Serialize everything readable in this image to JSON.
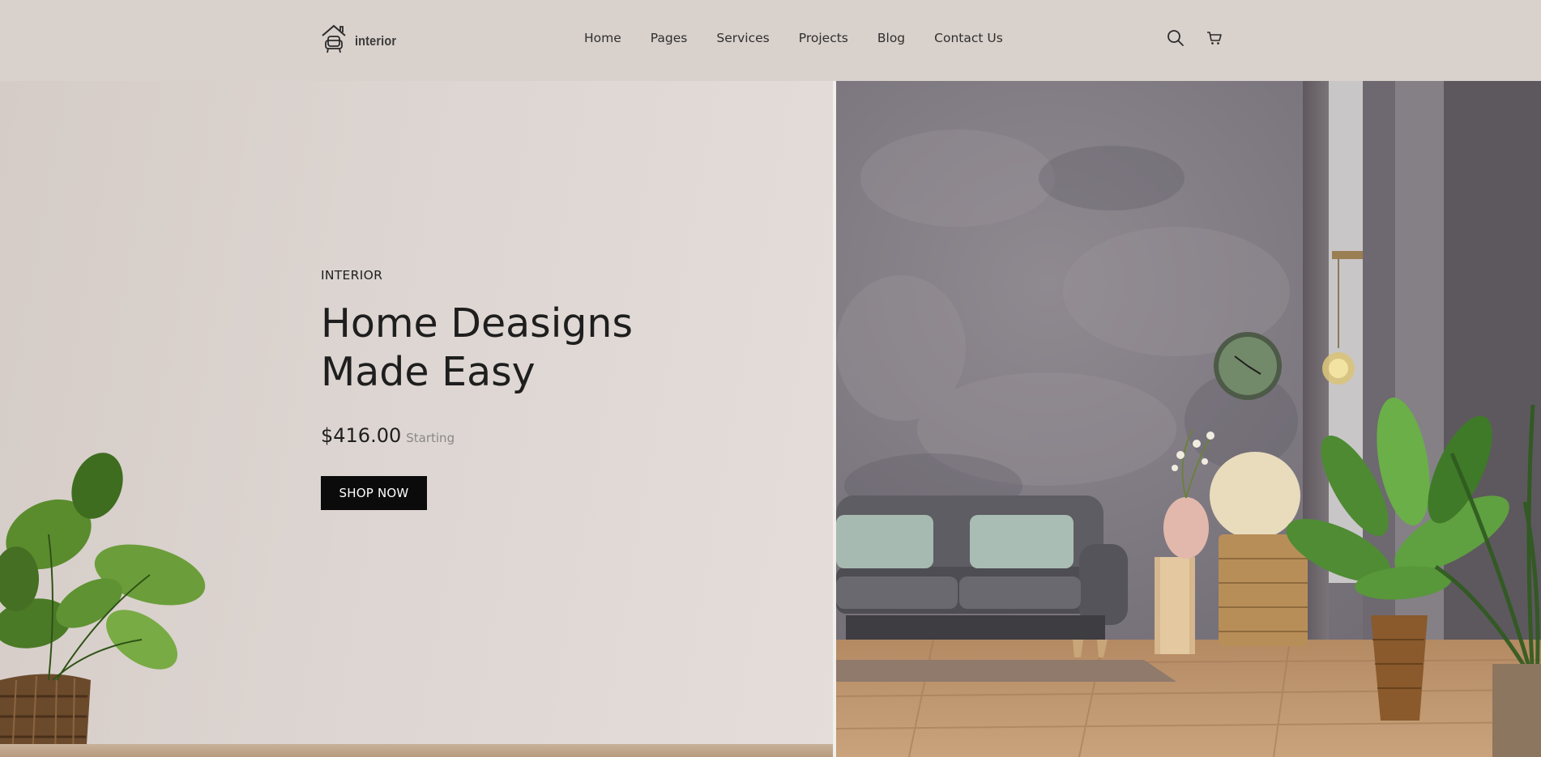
{
  "brand": {
    "name": "interior",
    "icon": "house-chair-logo-icon"
  },
  "nav": {
    "items": [
      {
        "label": "Home"
      },
      {
        "label": "Pages"
      },
      {
        "label": "Services"
      },
      {
        "label": "Projects"
      },
      {
        "label": "Blog"
      },
      {
        "label": "Contact Us"
      }
    ]
  },
  "header_icons": {
    "search": "search-icon",
    "cart": "cart-icon"
  },
  "hero": {
    "eyebrow": "INTERIOR",
    "title": "Home Deasigns Made Easy",
    "price": "$416.00",
    "price_note": "Starting",
    "cta": "SHOP NOW"
  },
  "colors": {
    "background": "#d9d1cc",
    "text": "#1e1e1e",
    "button": "#0b0b0b",
    "button_text": "#ffffff",
    "muted": "#888888"
  }
}
